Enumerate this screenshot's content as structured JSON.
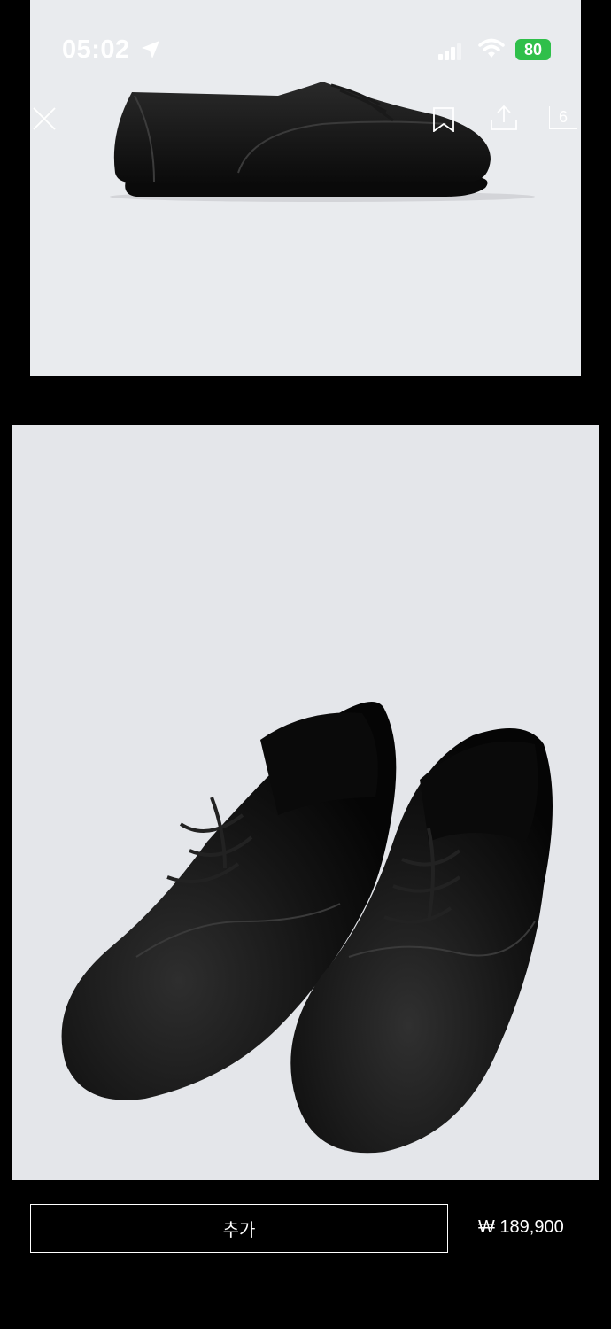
{
  "status_bar": {
    "time": "05:02",
    "battery": "80"
  },
  "header": {
    "image_count": "6"
  },
  "product": {
    "add_label": "추가",
    "price": "₩ 189,900"
  },
  "icons": [
    "location-arrow-icon",
    "signal-icon",
    "wifi-icon",
    "close-icon",
    "bookmark-icon",
    "share-icon"
  ],
  "colors": {
    "background": "#000000",
    "image_bg": "#e9ebee",
    "battery": "#2fbf4a"
  }
}
